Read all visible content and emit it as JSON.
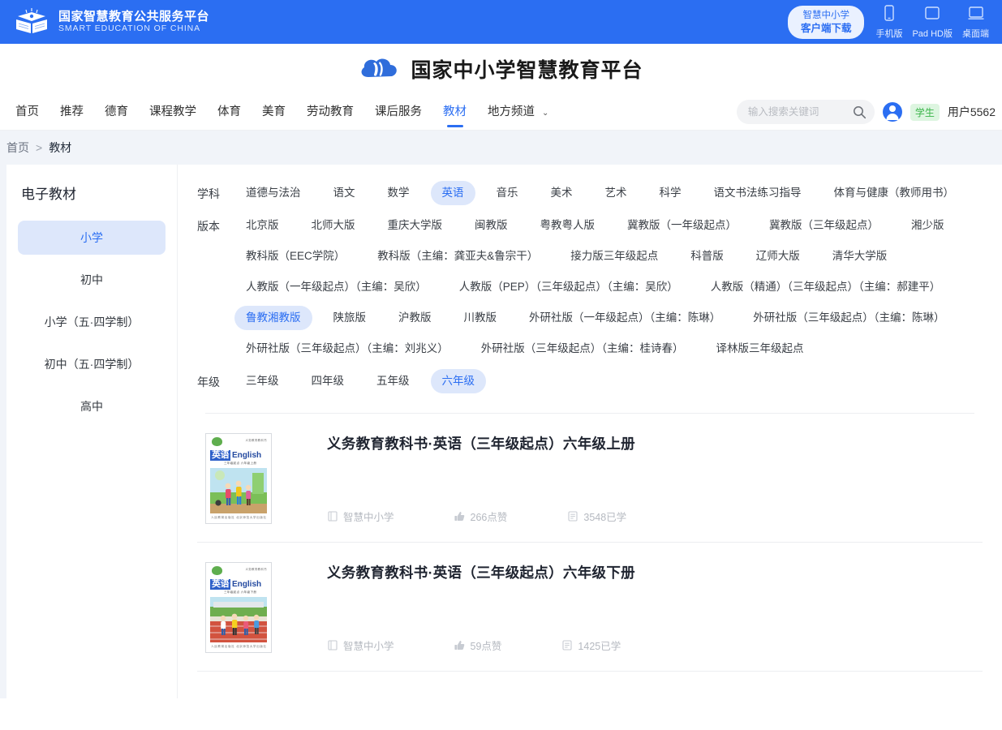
{
  "topbar": {
    "logo_cn": "国家智慧教育公共服务平台",
    "logo_en": "SMART EDUCATION OF CHINA",
    "download_line1": "智慧中小学",
    "download_line2": "客户端下载",
    "devices": [
      {
        "icon": "phone-icon",
        "label": "手机版"
      },
      {
        "icon": "tablet-icon",
        "label": "Pad HD版"
      },
      {
        "icon": "desktop-icon",
        "label": "桌面端"
      }
    ]
  },
  "brand": {
    "title": "国家中小学智慧教育平台",
    "icon": "cloud-logo-icon"
  },
  "nav": {
    "items": [
      {
        "label": "首页",
        "active": false
      },
      {
        "label": "推荐",
        "active": false
      },
      {
        "label": "德育",
        "active": false
      },
      {
        "label": "课程教学",
        "active": false
      },
      {
        "label": "体育",
        "active": false
      },
      {
        "label": "美育",
        "active": false
      },
      {
        "label": "劳动教育",
        "active": false
      },
      {
        "label": "课后服务",
        "active": false
      },
      {
        "label": "教材",
        "active": true
      },
      {
        "label": "地方频道",
        "active": false,
        "caret": "⌄"
      }
    ],
    "search_placeholder": "输入搜索关键词",
    "search_value": "",
    "search_icon": "search-icon",
    "role_badge": "学生",
    "user_name": "用户5562"
  },
  "breadcrumb": {
    "home": "首页",
    "separator": ">",
    "current": "教材"
  },
  "sidebar": {
    "title": "电子教材",
    "items": [
      {
        "label": "小学",
        "active": true
      },
      {
        "label": "初中",
        "active": false
      },
      {
        "label": "小学（五·四学制）",
        "active": false
      },
      {
        "label": "初中（五·四学制）",
        "active": false
      },
      {
        "label": "高中",
        "active": false
      }
    ]
  },
  "filters": [
    {
      "label": "学科",
      "options": [
        {
          "label": "道德与法治",
          "active": false
        },
        {
          "label": "语文",
          "active": false
        },
        {
          "label": "数学",
          "active": false
        },
        {
          "label": "英语",
          "active": true
        },
        {
          "label": "音乐",
          "active": false
        },
        {
          "label": "美术",
          "active": false
        },
        {
          "label": "艺术",
          "active": false
        },
        {
          "label": "科学",
          "active": false
        },
        {
          "label": "语文书法练习指导",
          "active": false
        },
        {
          "label": "体育与健康（教师用书）",
          "active": false
        }
      ]
    },
    {
      "label": "版本",
      "options": [
        {
          "label": "北京版",
          "active": false
        },
        {
          "label": "北师大版",
          "active": false
        },
        {
          "label": "重庆大学版",
          "active": false
        },
        {
          "label": "闽教版",
          "active": false
        },
        {
          "label": "粤教粤人版",
          "active": false
        },
        {
          "label": "冀教版（一年级起点）",
          "active": false
        },
        {
          "label": "冀教版（三年级起点）",
          "active": false
        },
        {
          "label": "湘少版",
          "active": false
        },
        {
          "label": "教科版（EEC学院）",
          "active": false
        },
        {
          "label": "教科版（主编：龚亚夫&鲁宗干）",
          "active": false
        },
        {
          "label": "接力版三年级起点",
          "active": false
        },
        {
          "label": "科普版",
          "active": false
        },
        {
          "label": "辽师大版",
          "active": false
        },
        {
          "label": "清华大学版",
          "active": false
        },
        {
          "label": "人教版（一年级起点）（主编：吴欣）",
          "active": false
        },
        {
          "label": "人教版（PEP）（三年级起点）（主编：吴欣）",
          "active": false
        },
        {
          "label": "人教版（精通）（三年级起点）（主编：郝建平）",
          "active": false
        },
        {
          "label": "鲁教湘教版",
          "active": true
        },
        {
          "label": "陕旅版",
          "active": false
        },
        {
          "label": "沪教版",
          "active": false
        },
        {
          "label": "川教版",
          "active": false
        },
        {
          "label": "外研社版（一年级起点）（主编：陈琳）",
          "active": false
        },
        {
          "label": "外研社版（三年级起点）（主编：陈琳）",
          "active": false
        },
        {
          "label": "外研社版（三年级起点）（主编：刘兆义）",
          "active": false
        },
        {
          "label": "外研社版（三年级起点）（主编：桂诗春）",
          "active": false
        },
        {
          "label": "译林版三年级起点",
          "active": false
        }
      ]
    },
    {
      "label": "年级",
      "options": [
        {
          "label": "三年级",
          "active": false
        },
        {
          "label": "四年级",
          "active": false
        },
        {
          "label": "五年级",
          "active": false
        },
        {
          "label": "六年级",
          "active": true
        }
      ]
    }
  ],
  "books": [
    {
      "title": "义务教育教科书·英语（三年级起点）六年级上册",
      "cover": {
        "cn": "英语",
        "en": "English",
        "top_text": "义务教育教科书",
        "sub_text": "三年级起点 六年级上册",
        "bottom_text": "人民教育出版社  北京师范大学出版社",
        "scene": "children-playing-outdoors"
      },
      "source": "智慧中小学",
      "likes": "266点赞",
      "studied": "3548已学"
    },
    {
      "title": "义务教育教科书·英语（三年级起点）六年级下册",
      "cover": {
        "cn": "英语",
        "en": "English",
        "top_text": "义务教育教科书",
        "sub_text": "三年级起点 六年级下册",
        "bottom_text": "人民教育出版社  北京师范大学出版社",
        "scene": "children-running-track"
      },
      "source": "智慧中小学",
      "likes": "59点赞",
      "studied": "1425已学"
    }
  ],
  "icons": {
    "source": "book-icon",
    "likes": "thumbs-up-icon",
    "studied": "study-icon"
  },
  "colors": {
    "brand_blue": "#2b6ef2",
    "chip_active_bg": "#dde7fb",
    "badge_green": "#3bb54a",
    "page_bg": "#f1f4f9"
  }
}
